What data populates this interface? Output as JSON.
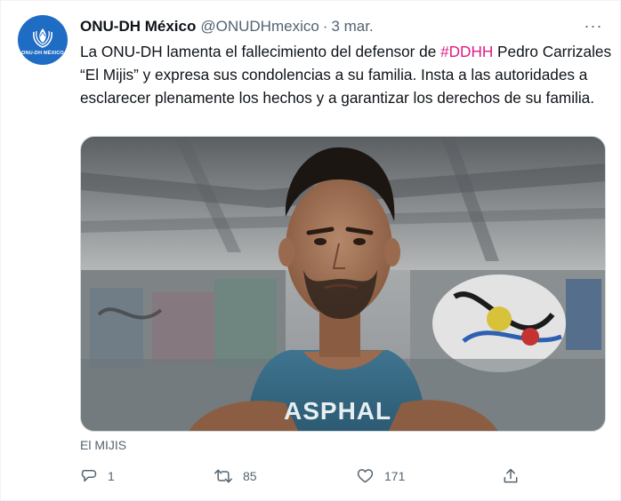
{
  "tweet": {
    "avatar_text": "ONU-DH MÉXICO",
    "display_name": "ONU-DH México",
    "handle": "@ONUDHmexico",
    "separator": "·",
    "time": "3 mar.",
    "more": "···",
    "text_part1": "La ONU-DH lamenta el fallecimiento del defensor de ",
    "hashtag": "#DDHH",
    "text_part2": " Pedro Carrizales “El Mijis” y expresa sus condolencias a su familia. Insta a las autoridades a esclarecer plenamente los hechos y a garantizar los derechos de su familia.",
    "media_caption": "El MIJIS",
    "shirt_print": "ASPHAL"
  },
  "actions": {
    "reply_count": "1",
    "retweet_count": "85",
    "like_count": "171"
  },
  "icons": {
    "reply": "speech-bubble-icon",
    "retweet": "retweet-icon",
    "like": "heart-icon",
    "share": "share-icon"
  },
  "colors": {
    "hashtag": "#e01b84",
    "avatar_bg": "#1f6cc5",
    "secondary_text": "#536471"
  }
}
